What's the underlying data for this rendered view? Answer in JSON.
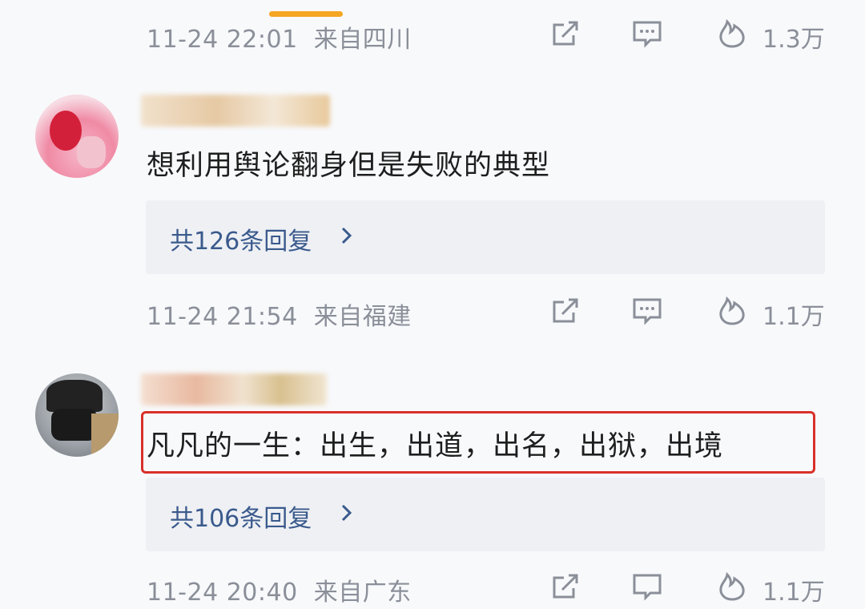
{
  "comments_top_meta": {
    "time": "11-24 22:01",
    "location": "来自四川",
    "likes": "1.3万"
  },
  "comments": [
    {
      "text": "想利用舆论翻身但是失败的典型",
      "reply_summary": "共126条回复",
      "time": "11-24 21:54",
      "location": "来自福建",
      "likes": "1.1万"
    },
    {
      "text": "凡凡的一生：出生，出道，出名，出狱，出境",
      "reply_summary": "共106条回复",
      "time": "11-24 20:40",
      "location": "来自广东",
      "likes": "1.1万"
    }
  ],
  "icons": {
    "share": "share-icon",
    "comment": "comment-icon",
    "like": "flame-like-icon",
    "chevron": "chevron-right-icon"
  },
  "colors": {
    "highlight": "#d9302a",
    "link": "#3a5a8c",
    "meta": "#8a8f99",
    "indicator": "#f5a623"
  }
}
